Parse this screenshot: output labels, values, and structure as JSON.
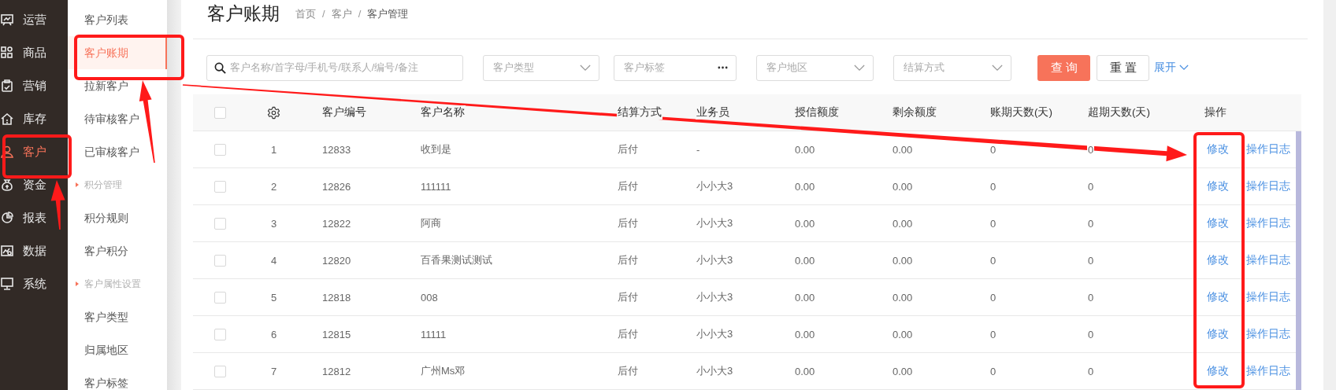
{
  "nav": [
    {
      "label": "运营",
      "selected": false
    },
    {
      "label": "商品",
      "selected": false
    },
    {
      "label": "营销",
      "selected": false
    },
    {
      "label": "库存",
      "selected": false
    },
    {
      "label": "客户",
      "selected": true
    },
    {
      "label": "资金",
      "selected": false
    },
    {
      "label": "报表",
      "selected": false
    },
    {
      "label": "数据",
      "selected": false
    },
    {
      "label": "系统",
      "selected": false
    }
  ],
  "submenu": [
    {
      "kind": "item",
      "label": "客户列表",
      "selected": false
    },
    {
      "kind": "item",
      "label": "客户账期",
      "selected": true
    },
    {
      "kind": "item",
      "label": "拉新客户",
      "selected": false
    },
    {
      "kind": "item",
      "label": "待审核客户",
      "selected": false
    },
    {
      "kind": "item",
      "label": "已审核客户",
      "selected": false
    },
    {
      "kind": "group",
      "label": "积分管理"
    },
    {
      "kind": "item",
      "label": "积分规则",
      "selected": false
    },
    {
      "kind": "item",
      "label": "客户积分",
      "selected": false
    },
    {
      "kind": "group",
      "label": "客户属性设置"
    },
    {
      "kind": "item",
      "label": "客户类型",
      "selected": false
    },
    {
      "kind": "item",
      "label": "归属地区",
      "selected": false
    },
    {
      "kind": "item",
      "label": "客户标签",
      "selected": false
    }
  ],
  "page": {
    "title": "客户账期",
    "breadcrumb": [
      {
        "kind": "link",
        "text": "首页"
      },
      {
        "kind": "sep",
        "text": "/"
      },
      {
        "kind": "link",
        "text": "客户"
      },
      {
        "kind": "sep",
        "text": "/"
      },
      {
        "kind": "current",
        "text": "客户管理"
      }
    ]
  },
  "filters": {
    "search": {
      "placeholder": "客户名称/首字母/手机号/联系人/编号/备注"
    },
    "selects": [
      {
        "kind": "dropdown",
        "placeholder": "客户类型"
      },
      {
        "kind": "more",
        "placeholder": "客户标签"
      },
      {
        "kind": "dropdown",
        "placeholder": "客户地区"
      },
      {
        "kind": "dropdown",
        "placeholder": "结算方式"
      }
    ],
    "buttons": [
      {
        "kind": "primary",
        "label": "查询"
      },
      {
        "kind": "default",
        "label": "重置"
      }
    ],
    "expand": "展开"
  },
  "table": {
    "all_checked": false,
    "columns": [
      "客户编号",
      "客户名称",
      "结算方式",
      "业务员",
      "授信额度",
      "剩余额度",
      "账期天数(天)",
      "超期天数(天)",
      "操作"
    ],
    "rows": [
      {
        "checked": false,
        "index": "1",
        "cells": [
          "12833",
          "收到是",
          "后付",
          "-",
          "0.00",
          "0.00",
          "0",
          "0"
        ],
        "actions": [
          "修改",
          "操作日志"
        ]
      },
      {
        "checked": false,
        "index": "2",
        "cells": [
          "12826",
          "111111",
          "后付",
          "小小大3",
          "0.00",
          "0.00",
          "0",
          "0"
        ],
        "actions": [
          "修改",
          "操作日志"
        ]
      },
      {
        "checked": false,
        "index": "3",
        "cells": [
          "12822",
          "阿商",
          "后付",
          "小小大3",
          "0.00",
          "0.00",
          "0",
          "0"
        ],
        "actions": [
          "修改",
          "操作日志"
        ]
      },
      {
        "checked": false,
        "index": "4",
        "cells": [
          "12820",
          "百香果测试测试",
          "后付",
          "小小大3",
          "0.00",
          "0.00",
          "0",
          "0"
        ],
        "actions": [
          "修改",
          "操作日志"
        ]
      },
      {
        "checked": false,
        "index": "5",
        "cells": [
          "12818",
          "008",
          "后付",
          "小小大3",
          "0.00",
          "0.00",
          "0",
          "0"
        ],
        "actions": [
          "修改",
          "操作日志"
        ]
      },
      {
        "checked": false,
        "index": "6",
        "cells": [
          "12815",
          "11111",
          "后付",
          "小小大3",
          "0.00",
          "0.00",
          "0",
          "0"
        ],
        "actions": [
          "修改",
          "操作日志"
        ]
      },
      {
        "checked": false,
        "index": "7",
        "cells": [
          "12812",
          "广州Ms邓",
          "后付",
          "小小大3",
          "0.00",
          "0.00",
          "0",
          "0"
        ],
        "actions": [
          "修改",
          "操作日志"
        ]
      }
    ]
  }
}
